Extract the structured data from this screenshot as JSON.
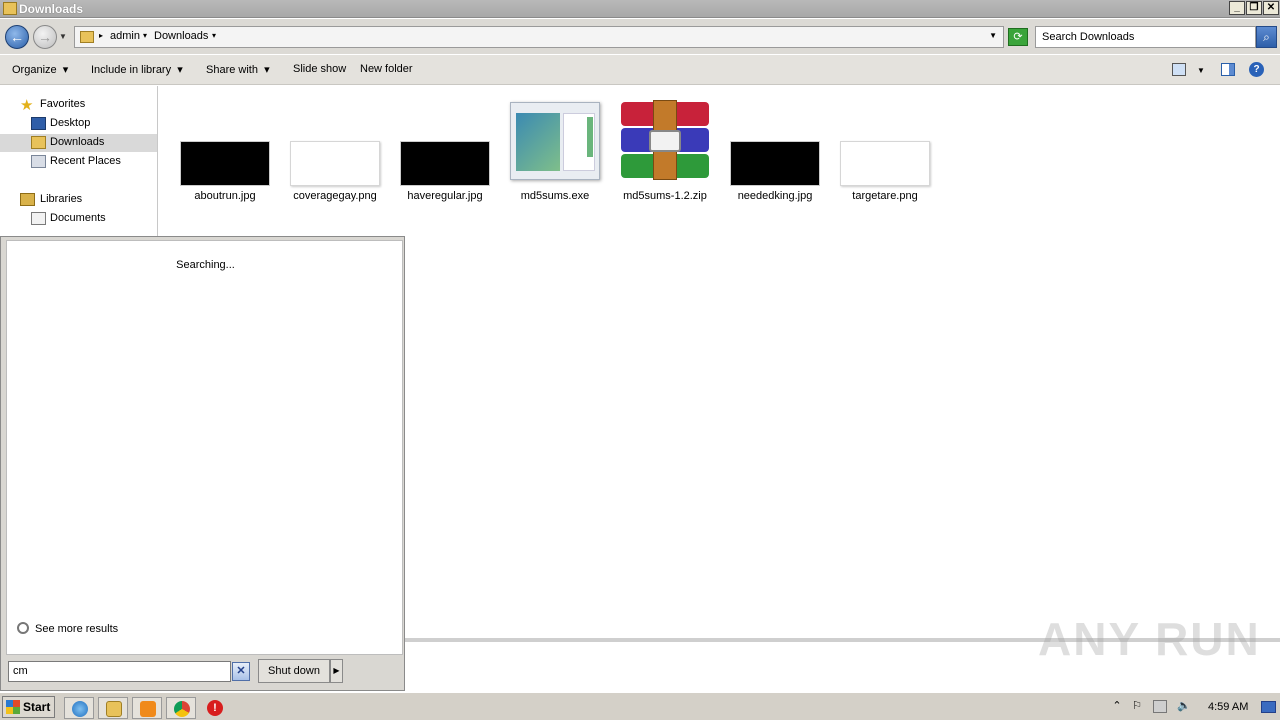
{
  "window": {
    "title": "Downloads",
    "controls": {
      "minimize": "_",
      "restore": "❐",
      "close": "✕"
    }
  },
  "address": {
    "back_icon": "back-arrow-icon",
    "forward_icon": "forward-arrow-icon",
    "crumbs": [
      "admin",
      "Downloads"
    ],
    "search_placeholder": "Search Downloads"
  },
  "toolbar": {
    "organize": "Organize",
    "include_in_library": "Include in library",
    "share_with": "Share with",
    "slide_show": "Slide show",
    "new_folder": "New folder"
  },
  "nav": {
    "favorites": "Favorites",
    "desktop": "Desktop",
    "downloads": "Downloads",
    "recent_places": "Recent Places",
    "libraries": "Libraries",
    "documents": "Documents"
  },
  "files": [
    {
      "name": "aboutrun.jpg",
      "thumb": "dark-image"
    },
    {
      "name": "coveragegay.png",
      "thumb": "white-image"
    },
    {
      "name": "haveregular.jpg",
      "thumb": "dark-image"
    },
    {
      "name": "md5sums.exe",
      "thumb": "exe-window"
    },
    {
      "name": "md5sums-1.2.zip",
      "thumb": "winrar-archive"
    },
    {
      "name": "neededking.jpg",
      "thumb": "dark-image"
    },
    {
      "name": "targetare.png",
      "thumb": "white-image"
    }
  ],
  "start_menu": {
    "status": "Searching...",
    "see_more": "See more results",
    "search_value": "cm",
    "shutdown": "Shut down"
  },
  "taskbar": {
    "start": "Start",
    "apps": [
      "internet-explorer-icon",
      "explorer-folder-icon",
      "media-player-icon",
      "chrome-icon",
      "antivirus-stop-icon"
    ],
    "clock": "4:59 AM"
  },
  "watermark": "ANY RUN"
}
